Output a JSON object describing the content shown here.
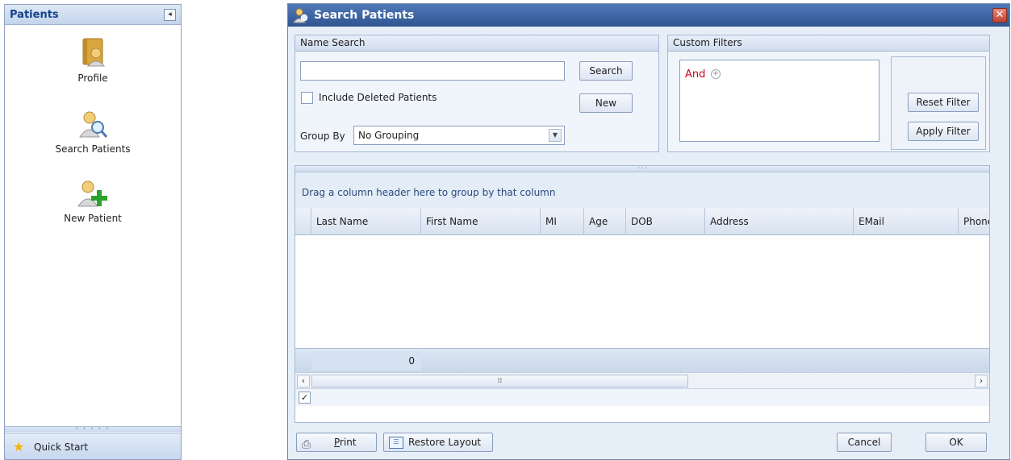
{
  "nav": {
    "title": "Patients",
    "items": [
      {
        "label": "Profile",
        "icon": "profile-folder-icon"
      },
      {
        "label": "Search Patients",
        "icon": "search-patient-icon"
      },
      {
        "label": "New Patient",
        "icon": "new-patient-icon"
      }
    ],
    "quick_start": "Quick Start"
  },
  "dialog": {
    "title": "Search Patients",
    "name_search": {
      "heading": "Name Search",
      "search_value": "",
      "search_button": "Search",
      "new_button": "New",
      "include_deleted_label": "Include Deleted Patients",
      "include_deleted_checked": false,
      "group_by_label": "Group By",
      "group_by_value": "No Grouping"
    },
    "custom_filters": {
      "heading": "Custom Filters",
      "and_label": "And",
      "reset_button": "Reset Filter",
      "apply_button": "Apply Filter"
    },
    "grid": {
      "group_hint": "Drag a column header here to group by that column",
      "columns": [
        "Last Name",
        "First Name",
        "MI",
        "Age",
        "DOB",
        "Address",
        "EMail",
        "Phone"
      ],
      "footer_count": "0"
    },
    "buttons": {
      "print": "Print",
      "restore_layout": "Restore Layout",
      "cancel": "Cancel",
      "ok": "OK"
    }
  },
  "colors": {
    "title_bar": "#3a629e",
    "filter_and": "#d0021b",
    "nav_title": "#15428b"
  }
}
